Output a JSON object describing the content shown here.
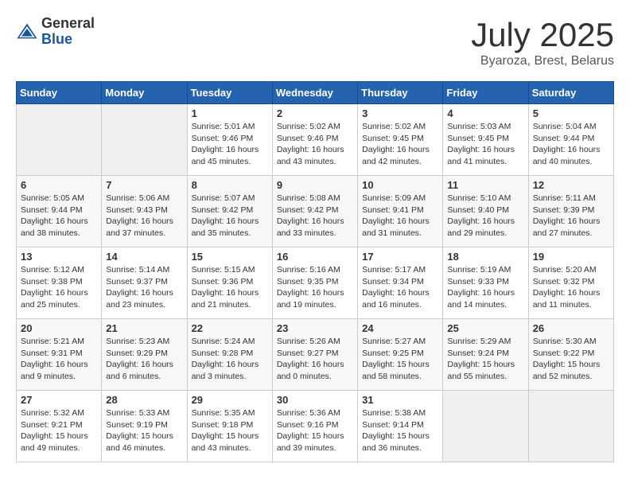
{
  "header": {
    "logo_general": "General",
    "logo_blue": "Blue",
    "title": "July 2025",
    "subtitle": "Byaroza, Brest, Belarus"
  },
  "days_of_week": [
    "Sunday",
    "Monday",
    "Tuesday",
    "Wednesday",
    "Thursday",
    "Friday",
    "Saturday"
  ],
  "weeks": [
    [
      {
        "day": "",
        "info": ""
      },
      {
        "day": "",
        "info": ""
      },
      {
        "day": "1",
        "info": "Sunrise: 5:01 AM\nSunset: 9:46 PM\nDaylight: 16 hours and 45 minutes."
      },
      {
        "day": "2",
        "info": "Sunrise: 5:02 AM\nSunset: 9:46 PM\nDaylight: 16 hours and 43 minutes."
      },
      {
        "day": "3",
        "info": "Sunrise: 5:02 AM\nSunset: 9:45 PM\nDaylight: 16 hours and 42 minutes."
      },
      {
        "day": "4",
        "info": "Sunrise: 5:03 AM\nSunset: 9:45 PM\nDaylight: 16 hours and 41 minutes."
      },
      {
        "day": "5",
        "info": "Sunrise: 5:04 AM\nSunset: 9:44 PM\nDaylight: 16 hours and 40 minutes."
      }
    ],
    [
      {
        "day": "6",
        "info": "Sunrise: 5:05 AM\nSunset: 9:44 PM\nDaylight: 16 hours and 38 minutes."
      },
      {
        "day": "7",
        "info": "Sunrise: 5:06 AM\nSunset: 9:43 PM\nDaylight: 16 hours and 37 minutes."
      },
      {
        "day": "8",
        "info": "Sunrise: 5:07 AM\nSunset: 9:42 PM\nDaylight: 16 hours and 35 minutes."
      },
      {
        "day": "9",
        "info": "Sunrise: 5:08 AM\nSunset: 9:42 PM\nDaylight: 16 hours and 33 minutes."
      },
      {
        "day": "10",
        "info": "Sunrise: 5:09 AM\nSunset: 9:41 PM\nDaylight: 16 hours and 31 minutes."
      },
      {
        "day": "11",
        "info": "Sunrise: 5:10 AM\nSunset: 9:40 PM\nDaylight: 16 hours and 29 minutes."
      },
      {
        "day": "12",
        "info": "Sunrise: 5:11 AM\nSunset: 9:39 PM\nDaylight: 16 hours and 27 minutes."
      }
    ],
    [
      {
        "day": "13",
        "info": "Sunrise: 5:12 AM\nSunset: 9:38 PM\nDaylight: 16 hours and 25 minutes."
      },
      {
        "day": "14",
        "info": "Sunrise: 5:14 AM\nSunset: 9:37 PM\nDaylight: 16 hours and 23 minutes."
      },
      {
        "day": "15",
        "info": "Sunrise: 5:15 AM\nSunset: 9:36 PM\nDaylight: 16 hours and 21 minutes."
      },
      {
        "day": "16",
        "info": "Sunrise: 5:16 AM\nSunset: 9:35 PM\nDaylight: 16 hours and 19 minutes."
      },
      {
        "day": "17",
        "info": "Sunrise: 5:17 AM\nSunset: 9:34 PM\nDaylight: 16 hours and 16 minutes."
      },
      {
        "day": "18",
        "info": "Sunrise: 5:19 AM\nSunset: 9:33 PM\nDaylight: 16 hours and 14 minutes."
      },
      {
        "day": "19",
        "info": "Sunrise: 5:20 AM\nSunset: 9:32 PM\nDaylight: 16 hours and 11 minutes."
      }
    ],
    [
      {
        "day": "20",
        "info": "Sunrise: 5:21 AM\nSunset: 9:31 PM\nDaylight: 16 hours and 9 minutes."
      },
      {
        "day": "21",
        "info": "Sunrise: 5:23 AM\nSunset: 9:29 PM\nDaylight: 16 hours and 6 minutes."
      },
      {
        "day": "22",
        "info": "Sunrise: 5:24 AM\nSunset: 9:28 PM\nDaylight: 16 hours and 3 minutes."
      },
      {
        "day": "23",
        "info": "Sunrise: 5:26 AM\nSunset: 9:27 PM\nDaylight: 16 hours and 0 minutes."
      },
      {
        "day": "24",
        "info": "Sunrise: 5:27 AM\nSunset: 9:25 PM\nDaylight: 15 hours and 58 minutes."
      },
      {
        "day": "25",
        "info": "Sunrise: 5:29 AM\nSunset: 9:24 PM\nDaylight: 15 hours and 55 minutes."
      },
      {
        "day": "26",
        "info": "Sunrise: 5:30 AM\nSunset: 9:22 PM\nDaylight: 15 hours and 52 minutes."
      }
    ],
    [
      {
        "day": "27",
        "info": "Sunrise: 5:32 AM\nSunset: 9:21 PM\nDaylight: 15 hours and 49 minutes."
      },
      {
        "day": "28",
        "info": "Sunrise: 5:33 AM\nSunset: 9:19 PM\nDaylight: 15 hours and 46 minutes."
      },
      {
        "day": "29",
        "info": "Sunrise: 5:35 AM\nSunset: 9:18 PM\nDaylight: 15 hours and 43 minutes."
      },
      {
        "day": "30",
        "info": "Sunrise: 5:36 AM\nSunset: 9:16 PM\nDaylight: 15 hours and 39 minutes."
      },
      {
        "day": "31",
        "info": "Sunrise: 5:38 AM\nSunset: 9:14 PM\nDaylight: 15 hours and 36 minutes."
      },
      {
        "day": "",
        "info": ""
      },
      {
        "day": "",
        "info": ""
      }
    ]
  ]
}
